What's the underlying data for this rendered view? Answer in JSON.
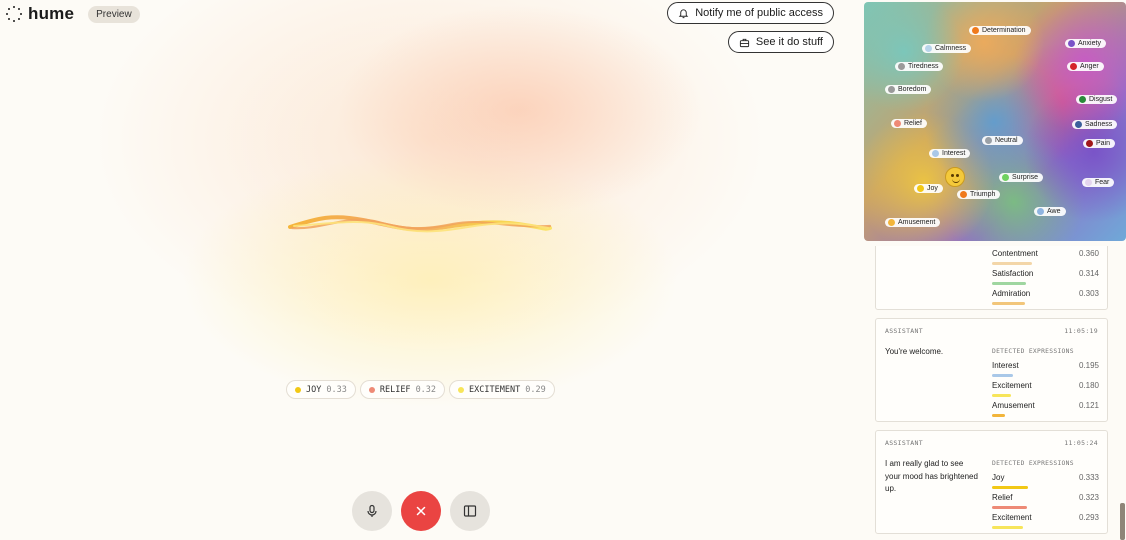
{
  "brand": {
    "name": "hume",
    "badge": "Preview"
  },
  "header": {
    "notify_label": "Notify me of public access",
    "see_label": "See it do stuff"
  },
  "expression_chips": [
    {
      "label": "JOY",
      "value": "0.33",
      "color": "#f2c814"
    },
    {
      "label": "RELIEF",
      "value": "0.32",
      "color": "#ee8a76"
    },
    {
      "label": "EXCITEMENT",
      "value": "0.29",
      "color": "#f7e55a"
    }
  ],
  "controls": {
    "mic_icon": "microphone-icon",
    "end_icon": "close-icon",
    "panel_icon": "sidebar-toggle-icon"
  },
  "emotion_map": {
    "labels": [
      {
        "text": "Determination",
        "color": "#f07a1c"
      },
      {
        "text": "Calmness",
        "color": "#b7d4ea"
      },
      {
        "text": "Anxiety",
        "color": "#7a52c8"
      },
      {
        "text": "Tiredness",
        "color": "#9a9a9a"
      },
      {
        "text": "Anger",
        "color": "#d4232a"
      },
      {
        "text": "Boredom",
        "color": "#9a9a9a"
      },
      {
        "text": "Disgust",
        "color": "#2a8a3a"
      },
      {
        "text": "Relief",
        "color": "#ee8a76"
      },
      {
        "text": "Sadness",
        "color": "#3c5f9c"
      },
      {
        "text": "Neutral",
        "color": "#9aa0a6"
      },
      {
        "text": "Pain",
        "color": "#a0161a"
      },
      {
        "text": "Interest",
        "color": "#a9c8e8"
      },
      {
        "text": "Surprise",
        "color": "#6fd160"
      },
      {
        "text": "Fear",
        "color": "#e4d4ee"
      },
      {
        "text": "Joy",
        "color": "#f2c814"
      },
      {
        "text": "Triumph",
        "color": "#f07a1c"
      },
      {
        "text": "Awe",
        "color": "#8fb4e0"
      },
      {
        "text": "Amusement",
        "color": "#f2b53a"
      }
    ]
  },
  "feed": {
    "card0": {
      "rows": [
        {
          "name": "Contentment",
          "value": "0.360",
          "color": "#f3d6a8"
        },
        {
          "name": "Satisfaction",
          "value": "0.314",
          "color": "#9fd6a0"
        },
        {
          "name": "Admiration",
          "value": "0.303",
          "color": "#f2c67a"
        }
      ]
    },
    "card1": {
      "role": "ASSISTANT",
      "time": "11:05:19",
      "message": "You're welcome.",
      "detected": "DETECTED EXPRESSIONS",
      "rows": [
        {
          "name": "Interest",
          "value": "0.195",
          "color": "#a9c8e8"
        },
        {
          "name": "Excitement",
          "value": "0.180",
          "color": "#f7e55a"
        },
        {
          "name": "Amusement",
          "value": "0.121",
          "color": "#f2b53a"
        }
      ]
    },
    "card2": {
      "role": "ASSISTANT",
      "time": "11:05:24",
      "message": "I am really glad to see your mood has brightened up.",
      "detected": "DETECTED EXPRESSIONS",
      "rows": [
        {
          "name": "Joy",
          "value": "0.333",
          "color": "#f2c814"
        },
        {
          "name": "Relief",
          "value": "0.323",
          "color": "#ee8a76"
        },
        {
          "name": "Excitement",
          "value": "0.293",
          "color": "#f7e55a"
        }
      ]
    }
  }
}
